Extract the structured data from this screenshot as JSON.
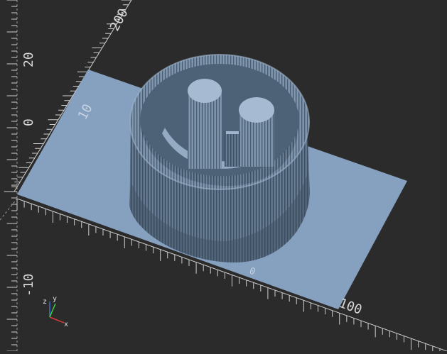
{
  "viewport": {
    "background": "#2b2b2b",
    "plate_color": "#86a0bf",
    "model_color": "#5d7389",
    "model_shadow": "#3c4b5b",
    "axis_color": "#d9d9d9",
    "axis_x_color": "#d43a3a",
    "axis_y_color": "#3ad43a",
    "axis_z_color": "#3a6ed4"
  },
  "axis_labels": {
    "top_200": "200",
    "left_20": "20",
    "left_0": "0",
    "left_neg10": "-10",
    "bottom_100": "100",
    "plate_10": "10",
    "plate_small": "0"
  },
  "indicator": {
    "x_label": "x",
    "y_label": "y",
    "z_label": "z"
  }
}
